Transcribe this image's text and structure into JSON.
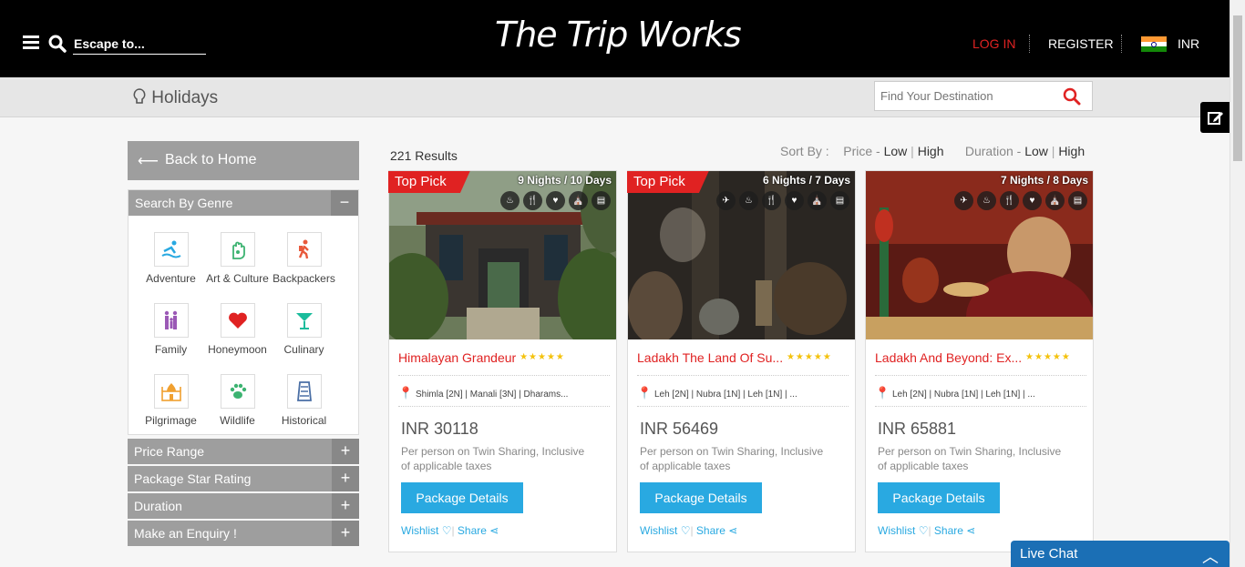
{
  "header": {
    "search_placeholder": "Escape to...",
    "logo_text": "The Trip Works",
    "login_label": "LOG IN",
    "register_label": "REGISTER",
    "currency": "INR"
  },
  "subheader": {
    "section_title": "Holidays",
    "find_placeholder": "Find Your Destination"
  },
  "sidebar": {
    "back_label": "Back to Home",
    "genre_heading": "Search By Genre",
    "genres": [
      {
        "label": "Adventure",
        "icon": "adventure-icon",
        "glyph": "🏄"
      },
      {
        "label": "Art & Culture",
        "icon": "art-culture-icon",
        "glyph": "✋"
      },
      {
        "label": "Backpackers",
        "icon": "backpackers-icon",
        "glyph": "🚶"
      },
      {
        "label": "Family",
        "icon": "family-icon",
        "glyph": "👪"
      },
      {
        "label": "Honeymoon",
        "icon": "honeymoon-icon",
        "glyph": "❤"
      },
      {
        "label": "Culinary",
        "icon": "culinary-icon",
        "glyph": "🍸"
      },
      {
        "label": "Pilgrimage",
        "icon": "pilgrimage-icon",
        "glyph": "🕌"
      },
      {
        "label": "Wildlife",
        "icon": "wildlife-icon",
        "glyph": "🐾"
      },
      {
        "label": "Historical",
        "icon": "historical-icon",
        "glyph": "🏛"
      }
    ],
    "filters": [
      "Price Range",
      "Package Star Rating",
      "Duration",
      "Make an Enquiry !"
    ]
  },
  "listing": {
    "results_count": "221 Results",
    "sort_label": "Sort By :",
    "price_label": "Price -",
    "duration_label": "Duration -",
    "low": "Low",
    "high": "High",
    "divider": "|"
  },
  "packages": [
    {
      "title": "Himalayan Grandeur",
      "stars": "★★★★★",
      "nights": "9 Nights / 10 Days",
      "top_pick": "Top Pick",
      "route": "Shimla [2N] | Manali [3N] | Dharams...",
      "price": "INR 30118",
      "desc": "Per person on Twin Sharing, Inclusive of applicable taxes",
      "button": "Package Details",
      "wishlist": "Wishlist",
      "share": "Share"
    },
    {
      "title": "Ladakh The Land Of Su...",
      "stars": "★★★★★",
      "nights": "6 Nights / 7 Days",
      "top_pick": "Top Pick",
      "route": "Leh [2N] | Nubra [1N] | Leh [1N] | ...",
      "price": "INR 56469",
      "desc": "Per person on Twin Sharing, Inclusive of applicable taxes",
      "button": "Package Details",
      "wishlist": "Wishlist",
      "share": "Share"
    },
    {
      "title": "Ladakh And Beyond: Ex...",
      "stars": "★★★★★",
      "nights": "7 Nights / 8 Days",
      "top_pick": "",
      "route": "Leh [2N] | Nubra [1N] | Leh [1N] | ...",
      "price": "INR 65881",
      "desc": "Per person on Twin Sharing, Inclusive of applicable taxes",
      "button": "Package Details",
      "wishlist": "Wishlist",
      "share": "Share"
    }
  ],
  "live_chat": {
    "label": "Live Chat"
  },
  "colors": {
    "accent_red": "#e02222",
    "button_blue": "#29a9e1",
    "chat_blue": "#1b6fb5"
  }
}
